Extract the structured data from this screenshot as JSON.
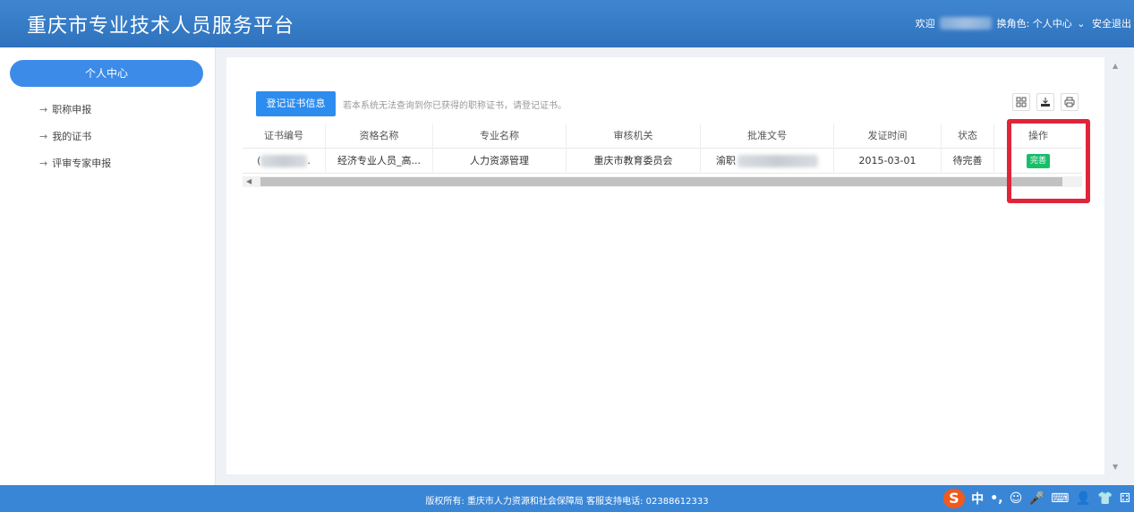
{
  "header": {
    "title": "重庆市专业技术人员服务平台",
    "welcome": "欢迎",
    "switch_role": "换角色: 个人中心",
    "chevron": "⌄",
    "logout": "安全退出"
  },
  "sidebar": {
    "main": "个人中心",
    "items": [
      {
        "arrow": "→",
        "label": "职称申报"
      },
      {
        "arrow": "→",
        "label": "我的证书"
      },
      {
        "arrow": "→",
        "label": "评审专家申报"
      }
    ]
  },
  "toolbar": {
    "register_button": "登记证书信息",
    "hint": "若本系统无法查询到你已获得的职称证书，请登记证书。",
    "icons": [
      "grid-icon",
      "export-icon",
      "print-icon"
    ]
  },
  "table": {
    "columns": [
      "证书编号",
      "资格名称",
      "专业名称",
      "审核机关",
      "批准文号",
      "发证时间",
      "状态",
      "操作"
    ],
    "rows": [
      {
        "cert_no_prefix": "(",
        "cert_no_suffix": ".",
        "qualification": "经济专业人员_高...",
        "major": "人力资源管理",
        "authority": "重庆市教育委员会",
        "approval_prefix": "渝职",
        "issue_date": "2015-03-01",
        "status": "待完善",
        "action": "完善"
      }
    ]
  },
  "footer": {
    "text": "版权所有: 重庆市人力资源和社会保障局 客服支持电话: 02388612333",
    "ime": [
      "S",
      "中",
      "•,",
      "☺",
      "🎤",
      "⌨",
      "👤",
      "👕",
      "⚃"
    ]
  },
  "colors": {
    "header": "#3a7fcb",
    "primary_button": "#2d8cf0",
    "success_button": "#19be6b",
    "highlight": "#e0243a",
    "footer": "#3a86d6"
  }
}
